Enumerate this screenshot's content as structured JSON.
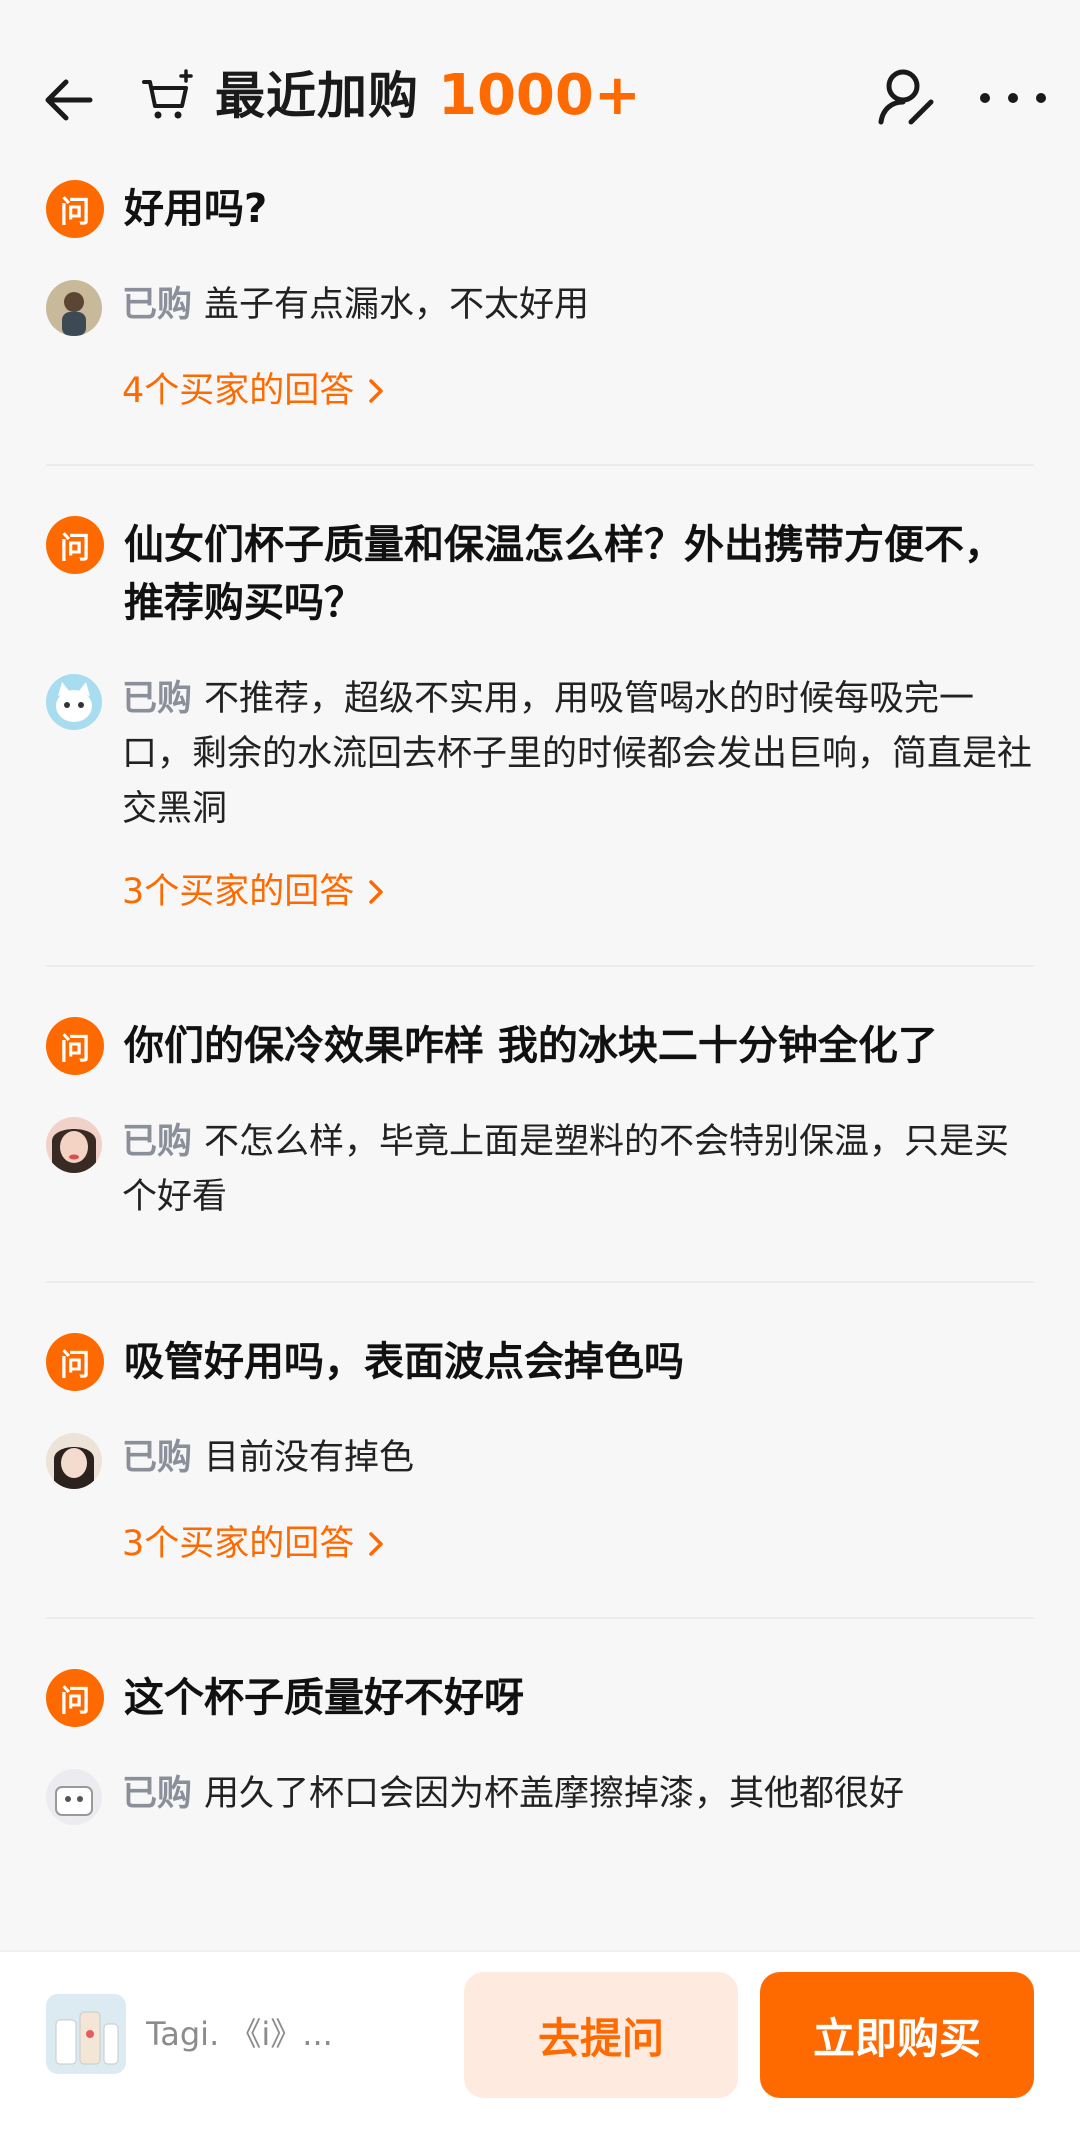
{
  "header": {
    "title": "最近加购",
    "count": "1000+"
  },
  "badge_label": "问",
  "bought_label": "已购",
  "qa_items": [
    {
      "question": "好用吗?",
      "answer": "盖子有点漏水，不太好用",
      "more_answers": "4个买家的回答",
      "avatar_color": "#b9a98a"
    },
    {
      "question": "仙女们杯子质量和保温怎么样？外出携带方便不，推荐购买吗？",
      "answer": "不推荐，超级不实用，用吸管喝水的时候每吸完一口，剩余的水流回去杯子里的时候都会发出巨响，简直是社交黑洞",
      "more_answers": "3个买家的回答",
      "avatar_color": "#9fd3e8"
    },
    {
      "question": "你们的保冷效果咋样 我的冰块二十分钟全化了",
      "answer": "不怎么样，毕竟上面是塑料的不会特别保温，只是买个好看",
      "more_answers": "",
      "avatar_color": "#d97a7a"
    },
    {
      "question": "吸管好用吗，表面波点会掉色吗",
      "answer": "目前没有掉色",
      "more_answers": "3个买家的回答",
      "avatar_color": "#e0c9b6"
    },
    {
      "question": "这个杯子质量好不好呀",
      "answer": "用久了杯口会因为杯盖摩擦掉漆，其他都很好",
      "more_answers": "",
      "avatar_color": "#c9c9cf"
    }
  ],
  "bottom": {
    "product_name": "Tagi. 《i》...",
    "ask_label": "去提问",
    "buy_label": "立即购买"
  },
  "colors": {
    "accent": "#ff6a00",
    "accent_light": "#ffeae0"
  }
}
